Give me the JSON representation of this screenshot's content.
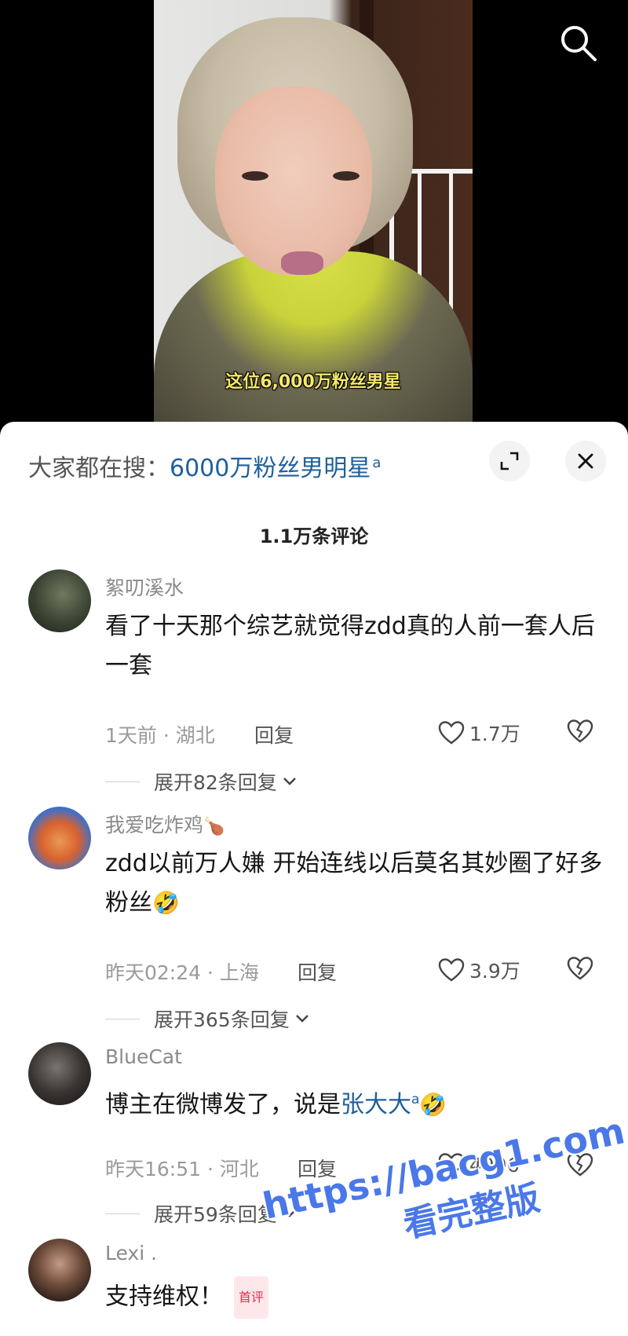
{
  "video": {
    "caption": "这位6,000万粉丝男星"
  },
  "sheet": {
    "search_prefix": "大家都在搜：",
    "search_term": "6000万粉丝男明星",
    "count_title": "1.1万条评论"
  },
  "comments": [
    {
      "user": "絮叨溪水",
      "text": "看了十天那个综艺就觉得zdd真的人前一套人后一套",
      "meta": "1天前 · 湖北",
      "reply": "回复",
      "likes": "1.7万",
      "expand": "展开82条回复"
    },
    {
      "user": "我爱吃炸鸡",
      "user_emoji": "🍗",
      "text": "zdd以前万人嫌 开始连线以后莫名其妙圈了好多粉丝",
      "emoji": "🤣",
      "meta": "昨天02:24 · 上海",
      "reply": "回复",
      "likes": "3.9万",
      "expand": "展开365条回复"
    },
    {
      "user": "BlueCat",
      "text_before": "博主在微博发了，说是",
      "text_link": "张大大",
      "emoji": "🤣",
      "meta": "昨天16:51 · 河北",
      "reply": "回复",
      "likes": "4996",
      "expand": "展开59条回复"
    },
    {
      "user": "Lexi .",
      "text": "支持维权！",
      "badge": "首评"
    }
  ],
  "watermark": {
    "line1": "https://bacg1.com",
    "line2": "看完整版"
  },
  "colors": {
    "link": "#1f5f9c",
    "caption": "#f5e76a",
    "watermark": "#4a78e8"
  }
}
